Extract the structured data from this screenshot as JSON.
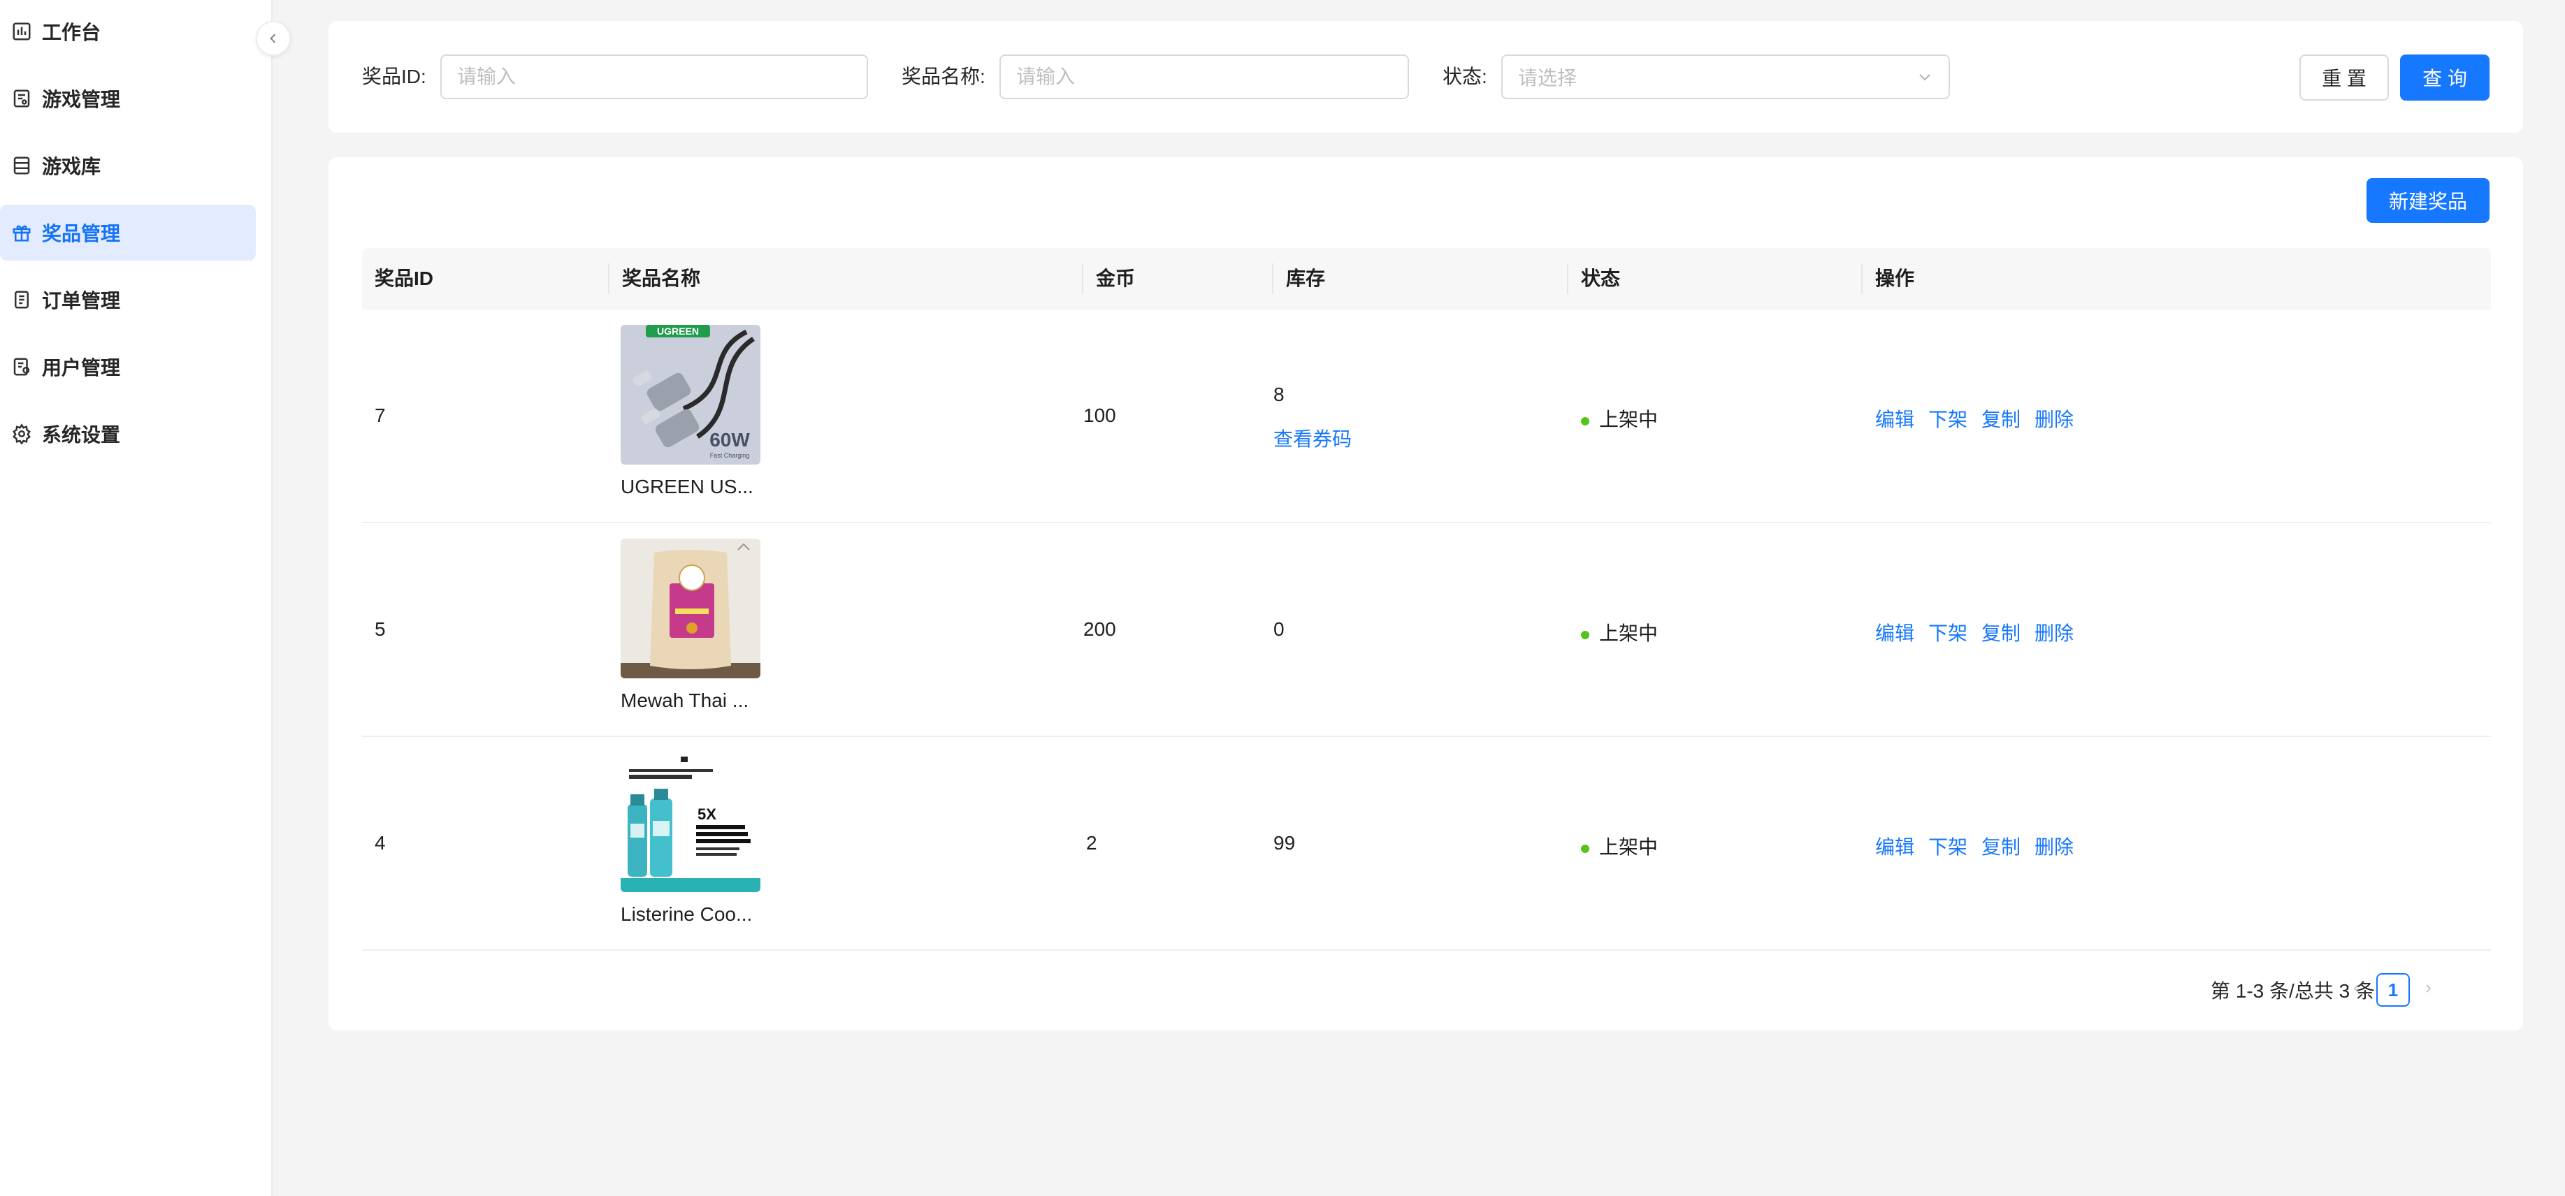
{
  "sidebar": {
    "items": [
      {
        "label": "工作台",
        "icon": "dashboard-icon"
      },
      {
        "label": "游戏管理",
        "icon": "game-management-icon"
      },
      {
        "label": "游戏库",
        "icon": "game-library-icon"
      },
      {
        "label": "奖品管理",
        "icon": "gift-icon",
        "active": true
      },
      {
        "label": "订单管理",
        "icon": "order-icon"
      },
      {
        "label": "用户管理",
        "icon": "user-icon"
      },
      {
        "label": "系统设置",
        "icon": "gear-icon"
      }
    ]
  },
  "filters": {
    "prize_id_label": "奖品ID:",
    "prize_id_placeholder": "请输入",
    "prize_name_label": "奖品名称:",
    "prize_name_placeholder": "请输入",
    "status_label": "状态:",
    "status_placeholder": "请选择",
    "reset_label": "重 置",
    "search_label": "查 询"
  },
  "toolbar": {
    "new_prize_label": "新建奖品"
  },
  "table": {
    "columns": [
      "奖品ID",
      "奖品名称",
      "金币",
      "库存",
      "状态",
      "操作"
    ],
    "rows": [
      {
        "id": "7",
        "name": "UGREEN US...",
        "coins": "100",
        "stock": "8",
        "stock_link": "查看券码",
        "status": "上架中",
        "image": "usb-cable-image"
      },
      {
        "id": "5",
        "name": "Mewah Thai ...",
        "coins": "200",
        "stock": "0",
        "stock_link": "",
        "status": "上架中",
        "image": "rice-bag-image"
      },
      {
        "id": "4",
        "name": "Listerine Coo...",
        "coins": "2",
        "stock": "99",
        "stock_link": "",
        "status": "上架中",
        "image": "mouthwash-image"
      }
    ],
    "actions": [
      "编辑",
      "下架",
      "复制",
      "删除"
    ]
  },
  "pagination": {
    "summary": "第 1-3 条/总共 3 条",
    "current_page": "1"
  },
  "colors": {
    "accent": "#1677ff",
    "active_nav_bg": "#e3ecfe",
    "status_green": "#52c41a"
  }
}
